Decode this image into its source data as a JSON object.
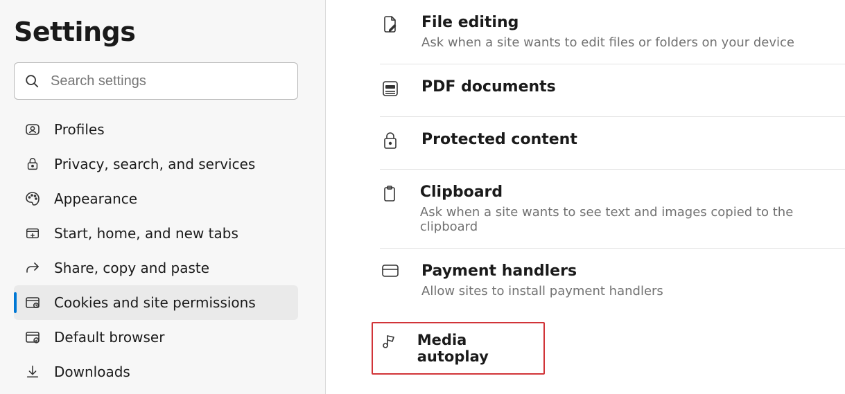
{
  "page_title": "Settings",
  "search": {
    "placeholder": "Search settings"
  },
  "sidebar": {
    "items": [
      {
        "label": "Profiles",
        "icon": "profiles-icon",
        "selected": false
      },
      {
        "label": "Privacy, search, and services",
        "icon": "lock-icon",
        "selected": false
      },
      {
        "label": "Appearance",
        "icon": "appearance-icon",
        "selected": false
      },
      {
        "label": "Start, home, and new tabs",
        "icon": "newtab-icon",
        "selected": false
      },
      {
        "label": "Share, copy and paste",
        "icon": "share-icon",
        "selected": false
      },
      {
        "label": "Cookies and site permissions",
        "icon": "cookies-icon",
        "selected": true
      },
      {
        "label": "Default browser",
        "icon": "browser-icon",
        "selected": false
      },
      {
        "label": "Downloads",
        "icon": "download-icon",
        "selected": false
      }
    ]
  },
  "permissions": [
    {
      "title": "File editing",
      "desc": "Ask when a site wants to edit files or folders on your device",
      "icon": "file-edit-icon"
    },
    {
      "title": "PDF documents",
      "desc": "",
      "icon": "pdf-icon"
    },
    {
      "title": "Protected content",
      "desc": "",
      "icon": "protected-icon"
    },
    {
      "title": "Clipboard",
      "desc": "Ask when a site wants to see text and images copied to the clipboard",
      "icon": "clipboard-icon"
    },
    {
      "title": "Payment handlers",
      "desc": "Allow sites to install payment handlers",
      "icon": "payment-icon"
    },
    {
      "title": "Media autoplay",
      "desc": "",
      "icon": "media-icon",
      "highlighted": true
    }
  ]
}
